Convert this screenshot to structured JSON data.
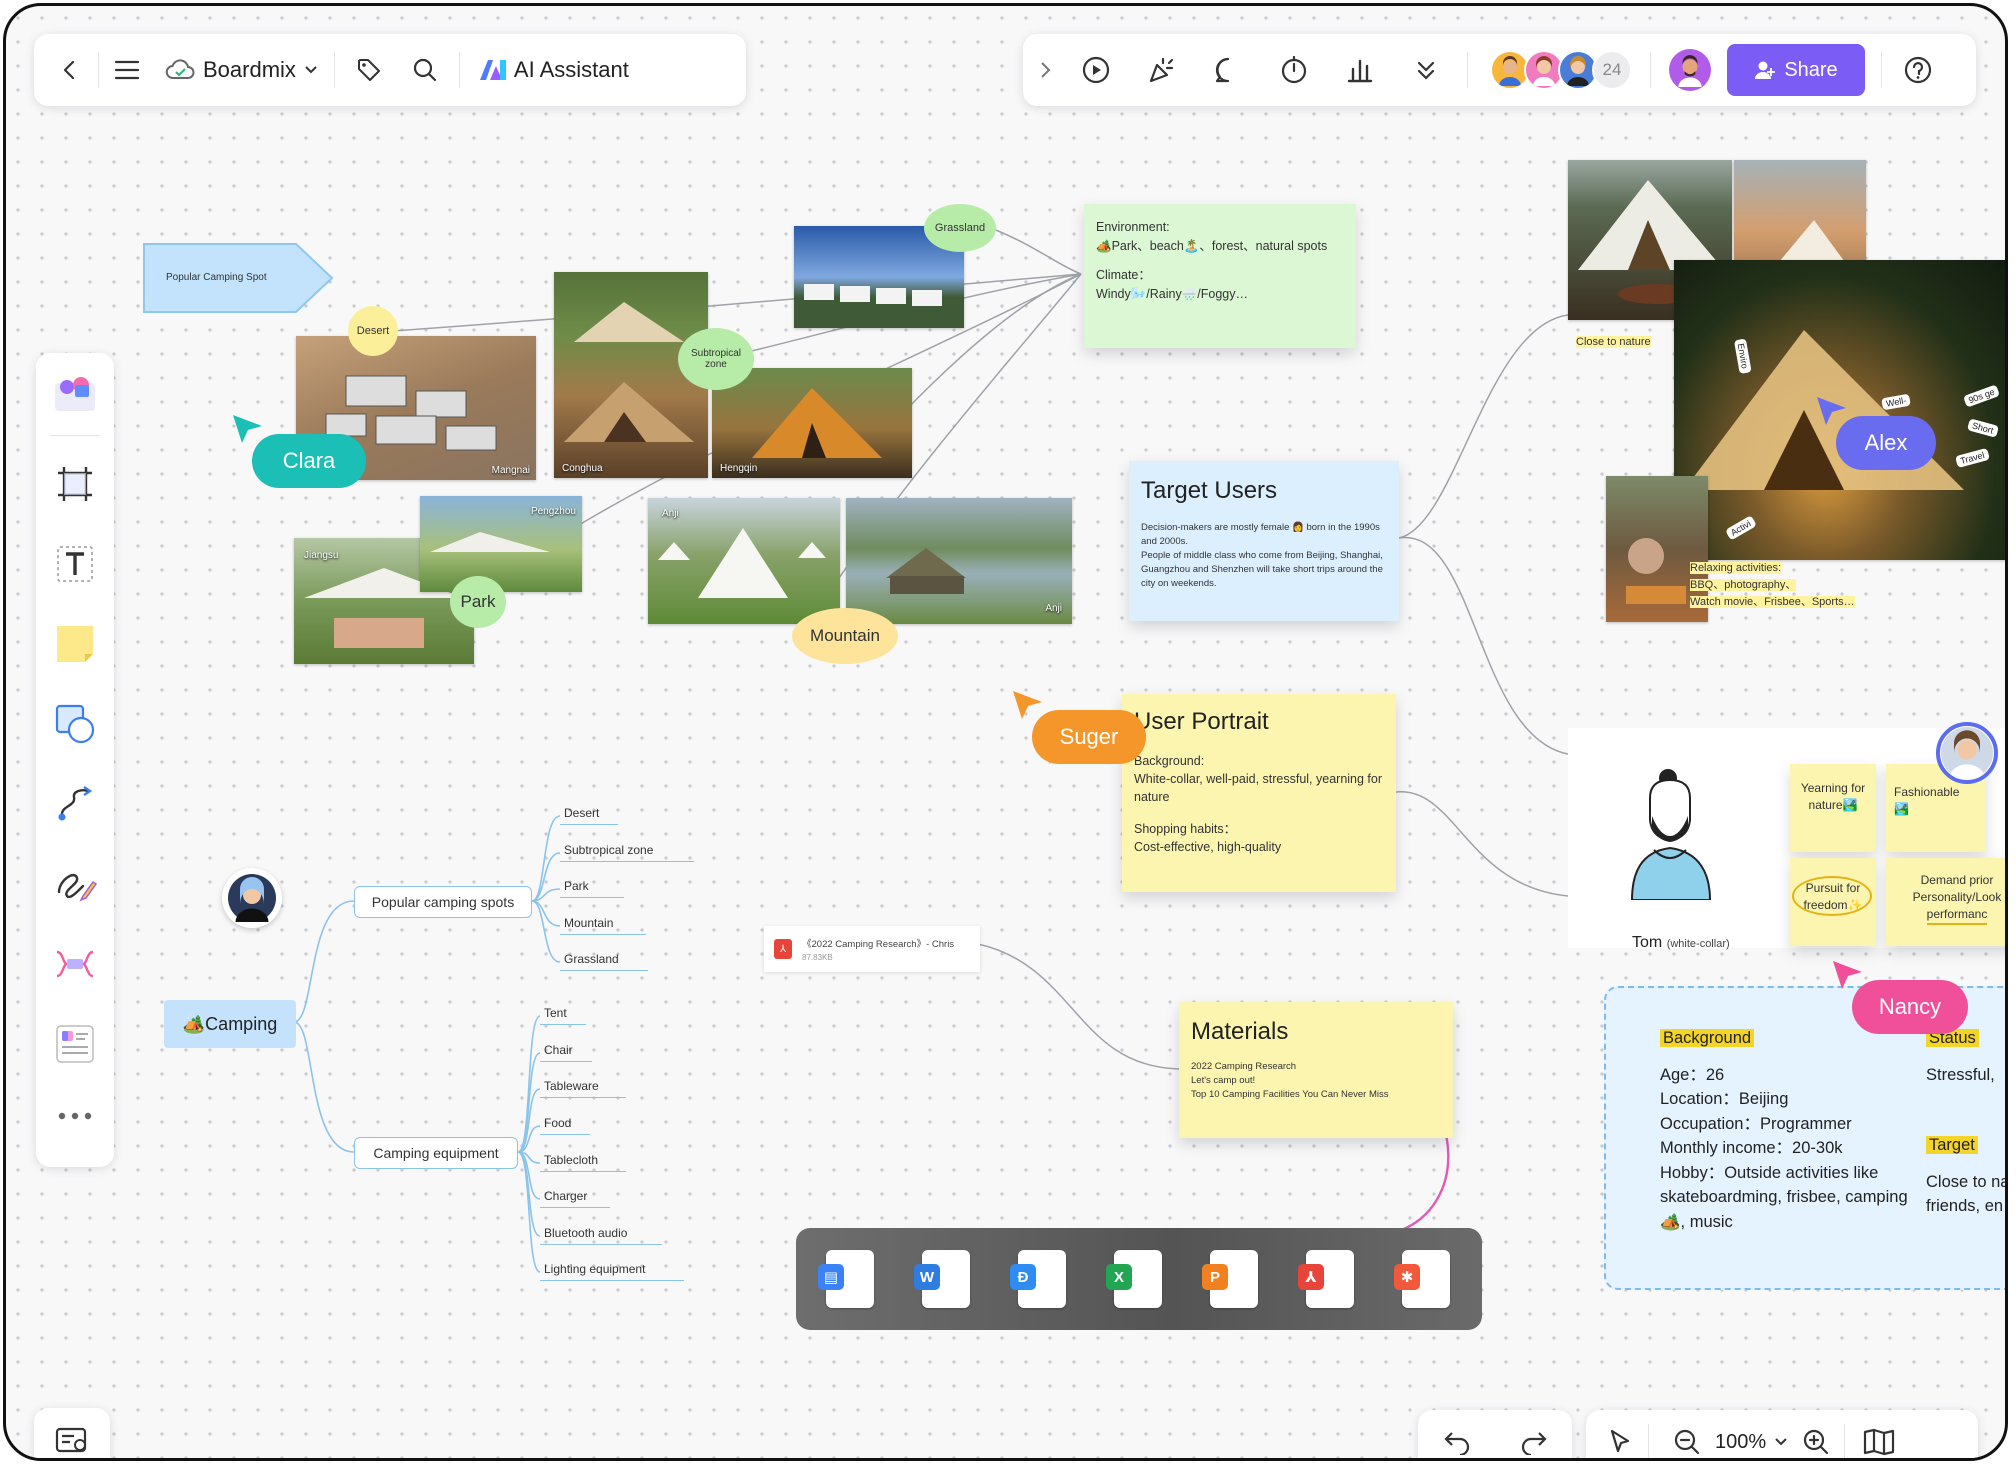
{
  "toolbar": {
    "app_name": "Boardmix",
    "ai_label": "AI Assistant",
    "collab_count": "24",
    "share_label": "Share",
    "accent": "#7b5cf5"
  },
  "zoom": {
    "label": "100%"
  },
  "board": {
    "tag_shape_text": "Popular Camping Spot",
    "bubbles": {
      "desert": "Desert",
      "grassland": "Grassland",
      "subtropical": "Subtropical zone",
      "park": "Park",
      "mountain": "Mountain"
    },
    "photo_captions": {
      "mangnai": "Mangnai",
      "conghua": "Conghua",
      "hengqin": "Hengqin",
      "jiangsu": "Jiangsu",
      "pengzhou": "Pengzhou",
      "anji1": "Anji",
      "anji2": "Anji"
    },
    "env_note": {
      "line1": "Environment:",
      "line2": "🏕️Park、beach🏝️、forest、natural spots",
      "line3": "Climate：",
      "line4": "Windy🌬️/Rainy🌧️/Foggy…"
    },
    "target_users": {
      "title": "Target Users",
      "body": "Decision-makers are mostly female 👩 born in the 1990s and 2000s.\nPeople of middle class who come from Beijing, Shanghai, Guangzhou and Shenzhen will take short trips around the city on weekends."
    },
    "user_portrait": {
      "title": "User Portrait",
      "l1": "Background:",
      "l2": "White-collar, well-paid, stressful, yearning for nature",
      "l3": "Shopping habits：",
      "l4": "Cost-effective, high-quality"
    },
    "materials": {
      "title": "Materials",
      "l1": "2022 Camping Research",
      "l2": "Let's camp out!",
      "l3": "Top 10 Camping Facilities You Can Never Miss"
    },
    "file_card": {
      "name": "《2022 Camping Research》- Chris",
      "size": "87.83KB"
    },
    "right_photos": {
      "close_label": "Close to nature",
      "tag_enviro": "Enviro",
      "tag_activi": "Activi",
      "tag_well": "Well-",
      "tag_90s": "90s ge",
      "tag_short": "Short",
      "tag_travel": "Travel",
      "relax1": "Relaxing activities:",
      "relax2": "BBQ、photography、",
      "relax3": "Watch movie、Frisbee、Sports…"
    },
    "persona": {
      "name": "Tom",
      "role": "(white-collar)",
      "n1": "Yearning for nature🏞️",
      "n2": "Fashionable",
      "n3": "Pursuit for freedom✨",
      "n4a": "Demand prior",
      "n4b": "Personality/Look",
      "n4c": "performanc"
    },
    "profile": {
      "bg_label": "Background",
      "age": "Age：26",
      "location": "Location：Beijing",
      "occupation": "Occupation：Programmer",
      "income": "Monthly income：20-30k",
      "hobby1": "Hobby：Outside activities like",
      "hobby2": "skateboardming, frisbee, camping",
      "hobby3": "🏕️, music",
      "status_label": "Status",
      "status_val": "Stressful, ",
      "target_label": "Target",
      "target1": "Close to na",
      "target2": "friends, en"
    },
    "cursors": {
      "clara": "Clara",
      "alex": "Alex",
      "suger": "Suger",
      "nancy": "Nancy"
    },
    "mindmap": {
      "root": "🏕️Camping",
      "branch1": "Popular camping spots",
      "branch2": "Camping equipment",
      "spots": [
        "Desert",
        "Subtropical zone",
        "Park",
        "Mountain",
        "Grassland"
      ],
      "equipment": [
        "Tent",
        "Chair",
        "Tableware",
        "Food",
        "Tablecloth",
        "Charger",
        "Bluetooth audio",
        "Lighting equipment"
      ]
    }
  },
  "colors": {
    "clara": "#1bbfb6",
    "alex": "#6a6cf0",
    "suger": "#f5962a",
    "nancy": "#f0509a",
    "sticky_yellow": "#fcf5b0",
    "sticky_green": "#dcf7d4",
    "sticky_blue": "#dcefff"
  }
}
